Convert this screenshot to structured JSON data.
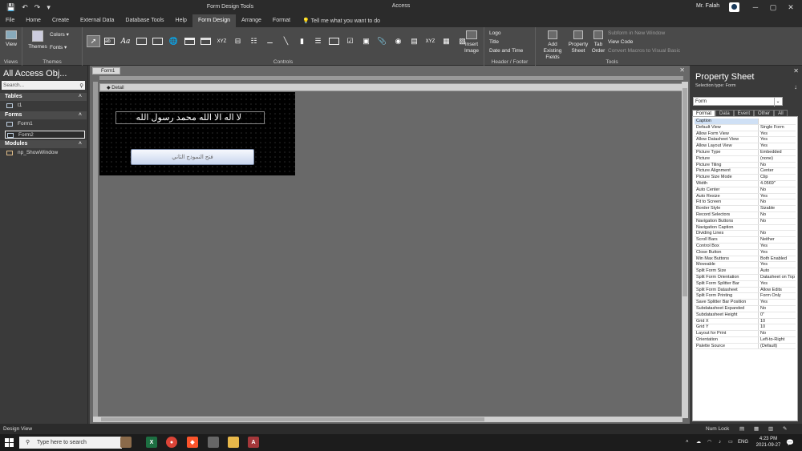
{
  "titlebar": {
    "qat": [
      "💾",
      "↶",
      "↷",
      "▾"
    ],
    "context_tools": "Form Design Tools",
    "app_title": "Access",
    "user": "Mr. Falah",
    "min": "─",
    "max": "▢",
    "close": "✕"
  },
  "tabs": [
    "File",
    "Home",
    "Create",
    "External Data",
    "Database Tools",
    "Help",
    "Form Design",
    "Arrange",
    "Format"
  ],
  "tell_me": "Tell me what you want to do",
  "ribbon": {
    "views_label": "View",
    "views_group": "Views",
    "themes_label": "Themes",
    "colors_label": "Colors ▾",
    "fonts_label": "Fonts ▾",
    "themes_group": "Themes",
    "controls_group": "Controls",
    "insert_image": "Insert Image",
    "header_footer_group": "Header / Footer",
    "logo": "Logo",
    "title": "Title",
    "date_time": "Date and Time",
    "add_fields": "Add Existing Fields",
    "property_sheet": "Property Sheet",
    "tab_order": "Tab Order",
    "subform": "Subform in New Window",
    "view_code": "View Code",
    "convert_macros": "Convert Macros to Visual Basic",
    "tools_group": "Tools"
  },
  "nav": {
    "title": "All Access Obj...",
    "search_placeholder": "Search...",
    "categories": [
      {
        "label": "Tables",
        "items": [
          "t1"
        ]
      },
      {
        "label": "Forms",
        "items": [
          "Form1",
          "Form2"
        ]
      },
      {
        "label": "Modules",
        "items": [
          "np_ShowWindow"
        ]
      }
    ]
  },
  "doc": {
    "tab": "Form1",
    "section": "◆ Detail",
    "form_label": "لا اله الا الله  محمد رسول الله",
    "form_button": "فتح النموذج الثاني"
  },
  "property_sheet": {
    "title": "Property Sheet",
    "selection_type": "Selection type:  Form",
    "selector": "Form",
    "tabs": [
      "Format",
      "Data",
      "Event",
      "Other",
      "All"
    ],
    "rows": [
      [
        "Caption",
        ""
      ],
      [
        "Default View",
        "Single Form"
      ],
      [
        "Allow Form View",
        "Yes"
      ],
      [
        "Allow Datasheet View",
        "Yes"
      ],
      [
        "Allow Layout View",
        "Yes"
      ],
      [
        "Picture Type",
        "Embedded"
      ],
      [
        "Picture",
        "(none)"
      ],
      [
        "Picture Tiling",
        "No"
      ],
      [
        "Picture Alignment",
        "Center"
      ],
      [
        "Picture Size Mode",
        "Clip"
      ],
      [
        "Width",
        "4.0569\""
      ],
      [
        "Auto Center",
        "No"
      ],
      [
        "Auto Resize",
        "Yes"
      ],
      [
        "Fit to Screen",
        "No"
      ],
      [
        "Border Style",
        "Sizable"
      ],
      [
        "Record Selectors",
        "No"
      ],
      [
        "Navigation Buttons",
        "No"
      ],
      [
        "Navigation Caption",
        ""
      ],
      [
        "Dividing Lines",
        "No"
      ],
      [
        "Scroll Bars",
        "Neither"
      ],
      [
        "Control Box",
        "Yes"
      ],
      [
        "Close Button",
        "Yes"
      ],
      [
        "Min Max Buttons",
        "Both Enabled"
      ],
      [
        "Moveable",
        "Yes"
      ],
      [
        "Split Form Size",
        "Auto"
      ],
      [
        "Split Form Orientation",
        "Datasheet on Top"
      ],
      [
        "Split Form Splitter Bar",
        "Yes"
      ],
      [
        "Split Form Datasheet",
        "Allow Edits"
      ],
      [
        "Split Form Printing",
        "Form Only"
      ],
      [
        "Save Splitter Bar Position",
        "Yes"
      ],
      [
        "Subdatasheet Expanded",
        "No"
      ],
      [
        "Subdatasheet Height",
        "0\""
      ],
      [
        "Grid X",
        "10"
      ],
      [
        "Grid Y",
        "10"
      ],
      [
        "Layout for Print",
        "No"
      ],
      [
        "Orientation",
        "Left-to-Right"
      ],
      [
        "Palette Source",
        "(Default)"
      ]
    ]
  },
  "status": {
    "left": "Design View",
    "numlock": "Num Lock"
  },
  "taskbar": {
    "search": "Type here to search",
    "lang": "ENG",
    "time": "4:23 PM",
    "date": "2021-09-27"
  }
}
